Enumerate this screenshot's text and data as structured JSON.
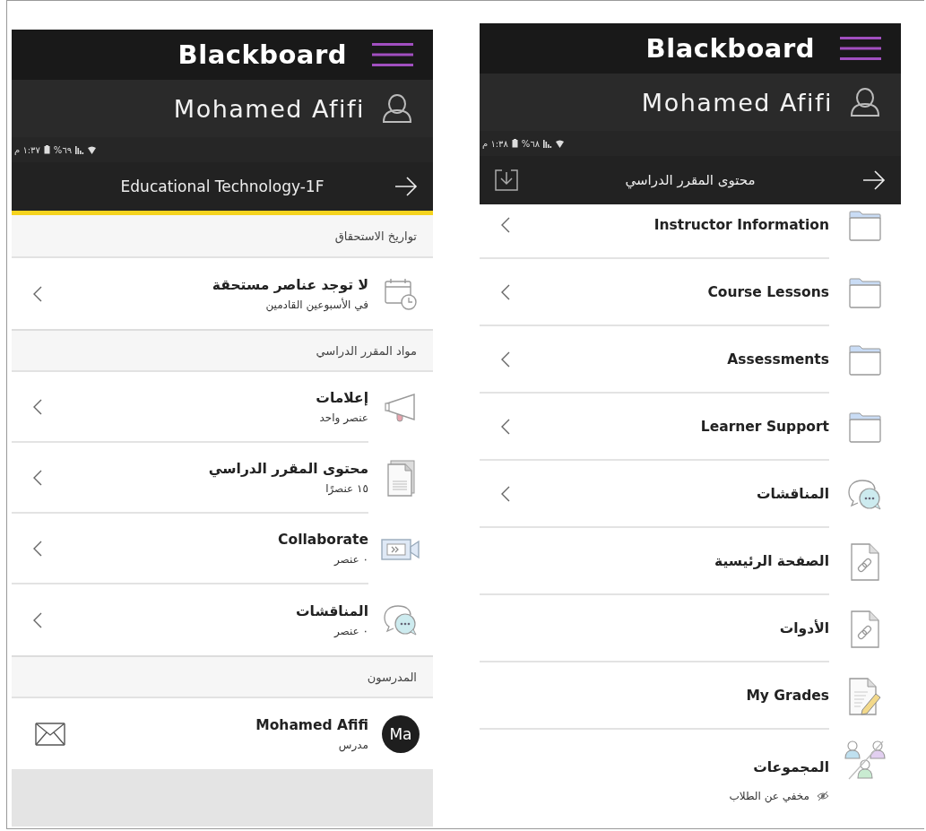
{
  "screens": [
    {
      "header": {
        "logo": "Blackboard"
      },
      "user": {
        "name": "Mohamed Afifi"
      },
      "status_bar": {
        "time": "١:٣٧ م",
        "battery": "%٦٩"
      },
      "title_bar": {
        "title": "Educational Technology-1F",
        "download": false,
        "accent": true
      },
      "sections": [
        {
          "heading": "تواريخ الاستحقاق",
          "items": [
            {
              "kind": "calendar",
              "title": "لا توجد عناصر مستحقة",
              "subtitle": "في الأسبوعين القادمين",
              "expandable": true
            }
          ]
        },
        {
          "heading": "مواد المقرر الدراسي",
          "items": [
            {
              "kind": "announcement",
              "title": "إعلامات",
              "subtitle": "عنصر واحد",
              "expandable": true
            },
            {
              "kind": "content",
              "title": "محتوى المقرر الدراسي",
              "subtitle": "١٥ عنصرًا",
              "expandable": true
            },
            {
              "kind": "collaborate",
              "title": "Collaborate",
              "subtitle": "٠ عنصر",
              "expandable": true
            },
            {
              "kind": "discussion",
              "title": "المناقشات",
              "subtitle": "٠ عنصر",
              "expandable": true
            }
          ]
        },
        {
          "heading": "المدرسون",
          "items": [
            {
              "kind": "person",
              "title": "Mohamed Afifi",
              "subtitle": "مدرس",
              "avatar": "Ma",
              "expandable": false
            }
          ]
        }
      ]
    },
    {
      "header": {
        "logo": "Blackboard"
      },
      "user": {
        "name": "Mohamed Afifi"
      },
      "status_bar": {
        "time": "١:٣٨ م",
        "battery": "%٦٨"
      },
      "title_bar": {
        "title": "محتوى المقرر الدراسي",
        "download": true,
        "accent": false
      },
      "sections": [
        {
          "items": [
            {
              "kind": "folder",
              "title": "Instructor Information",
              "expandable": true
            },
            {
              "kind": "folder",
              "title": "Course Lessons",
              "expandable": true
            },
            {
              "kind": "folder",
              "title": "Assessments",
              "expandable": true
            },
            {
              "kind": "folder",
              "title": "Learner Support",
              "expandable": true
            },
            {
              "kind": "discussion",
              "title": "المناقشات",
              "expandable": true
            },
            {
              "kind": "link",
              "title": "الصفحة الرئيسية",
              "expandable": false
            },
            {
              "kind": "link",
              "title": "الأدوات",
              "expandable": false
            },
            {
              "kind": "grades",
              "title": "My Grades",
              "expandable": false
            },
            {
              "kind": "groups",
              "title": "المجموعات",
              "note": "مخفي عن الطلاب",
              "expandable": false
            }
          ]
        }
      ]
    }
  ]
}
